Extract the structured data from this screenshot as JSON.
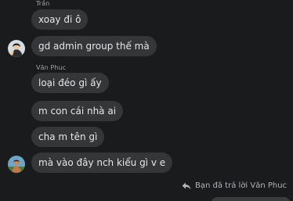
{
  "messages": [
    {
      "sender": "Trần",
      "texts": [
        "xoay đi ô",
        "gd admin group thế mà"
      ]
    },
    {
      "sender": "Văn Phuc",
      "texts": [
        "loại đéo gì ấy",
        "m con cái nhà ai",
        "cha m tên gì",
        "mà vào đây nch kiểu gì v e"
      ]
    }
  ],
  "reply_note": {
    "label": "Bạn đã trả lời Văn Phuc",
    "icon": "reply-arrow-icon"
  },
  "colors": {
    "background": "#1a1b1d",
    "bubble": "#343638",
    "text": "#e4e6eb",
    "secondary_text": "#a0a3a8"
  }
}
